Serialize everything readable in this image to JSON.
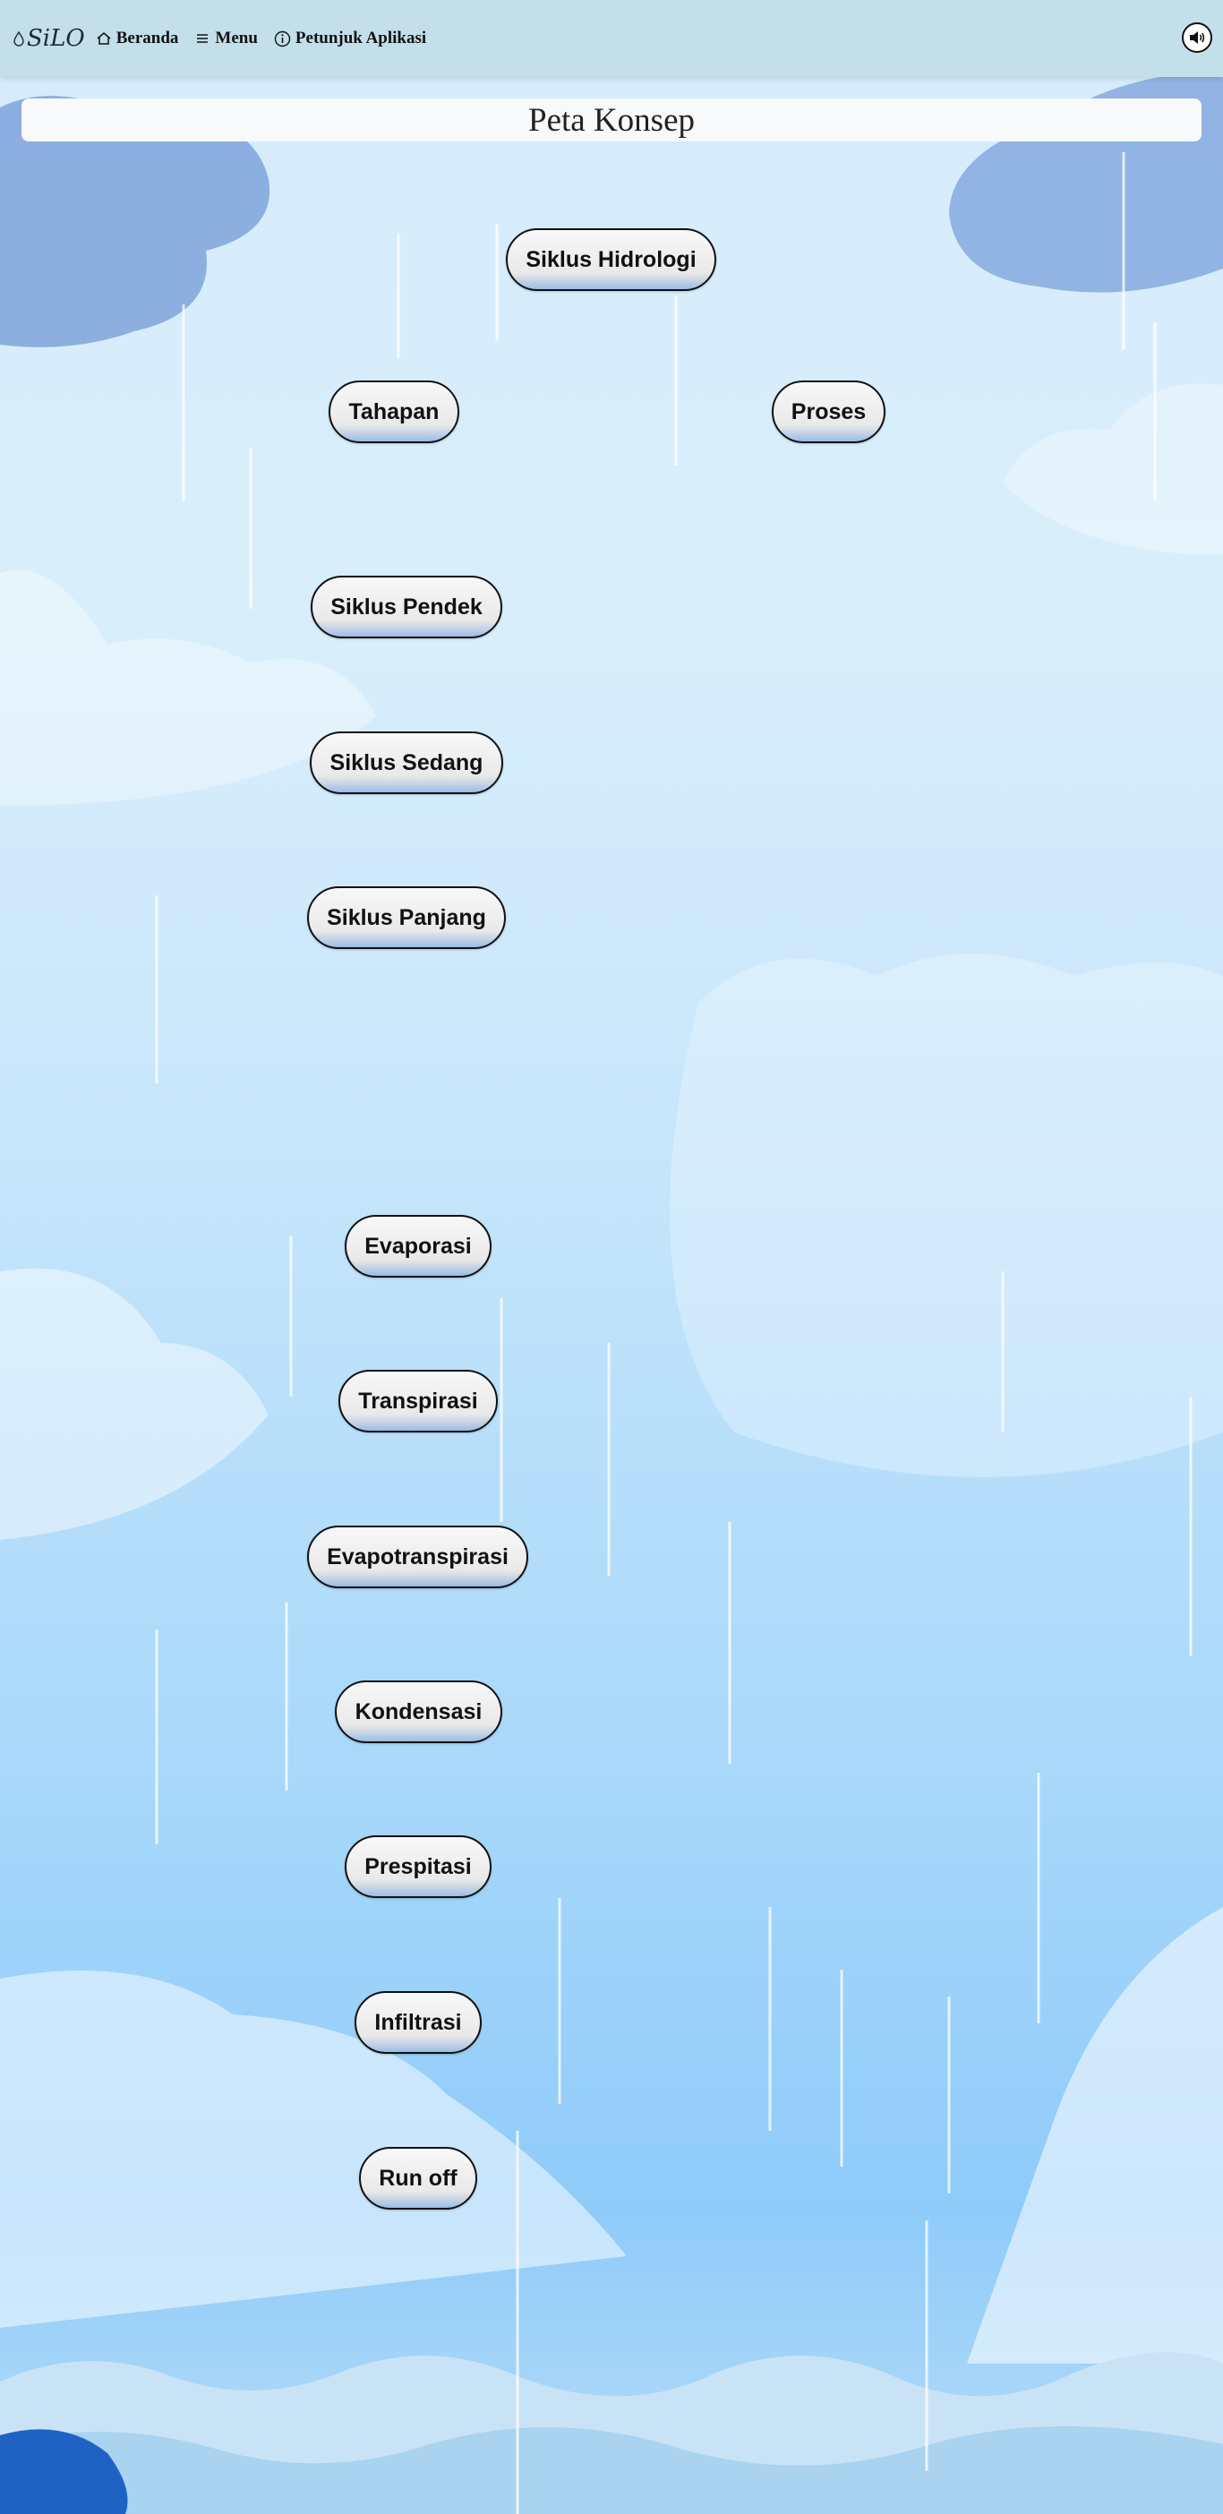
{
  "navbar": {
    "logo_text": "SiLO",
    "home_label": "Beranda",
    "menu_label": "Menu",
    "guide_label": "Petunjuk Aplikasi",
    "sound_icon": "speaker-volume-icon"
  },
  "page": {
    "title": "Peta Konsep"
  },
  "concept_map": {
    "root": "Siklus Hidrologi",
    "branches": [
      "Tahapan",
      "Proses"
    ],
    "tahapan_items": [
      "Siklus Pendek",
      "Siklus Sedang",
      "Siklus Panjang"
    ],
    "proses_items": [
      "Evaporasi",
      "Transpirasi",
      "Evapotranspirasi",
      "Kondensasi",
      "Prespitasi",
      "Infiltrasi",
      "Run off"
    ]
  },
  "colors": {
    "navbar_bg": "#c2dfea",
    "sky_top": "#d6ecfb",
    "sky_bottom": "#8fcbfa",
    "node_border": "#111111"
  }
}
